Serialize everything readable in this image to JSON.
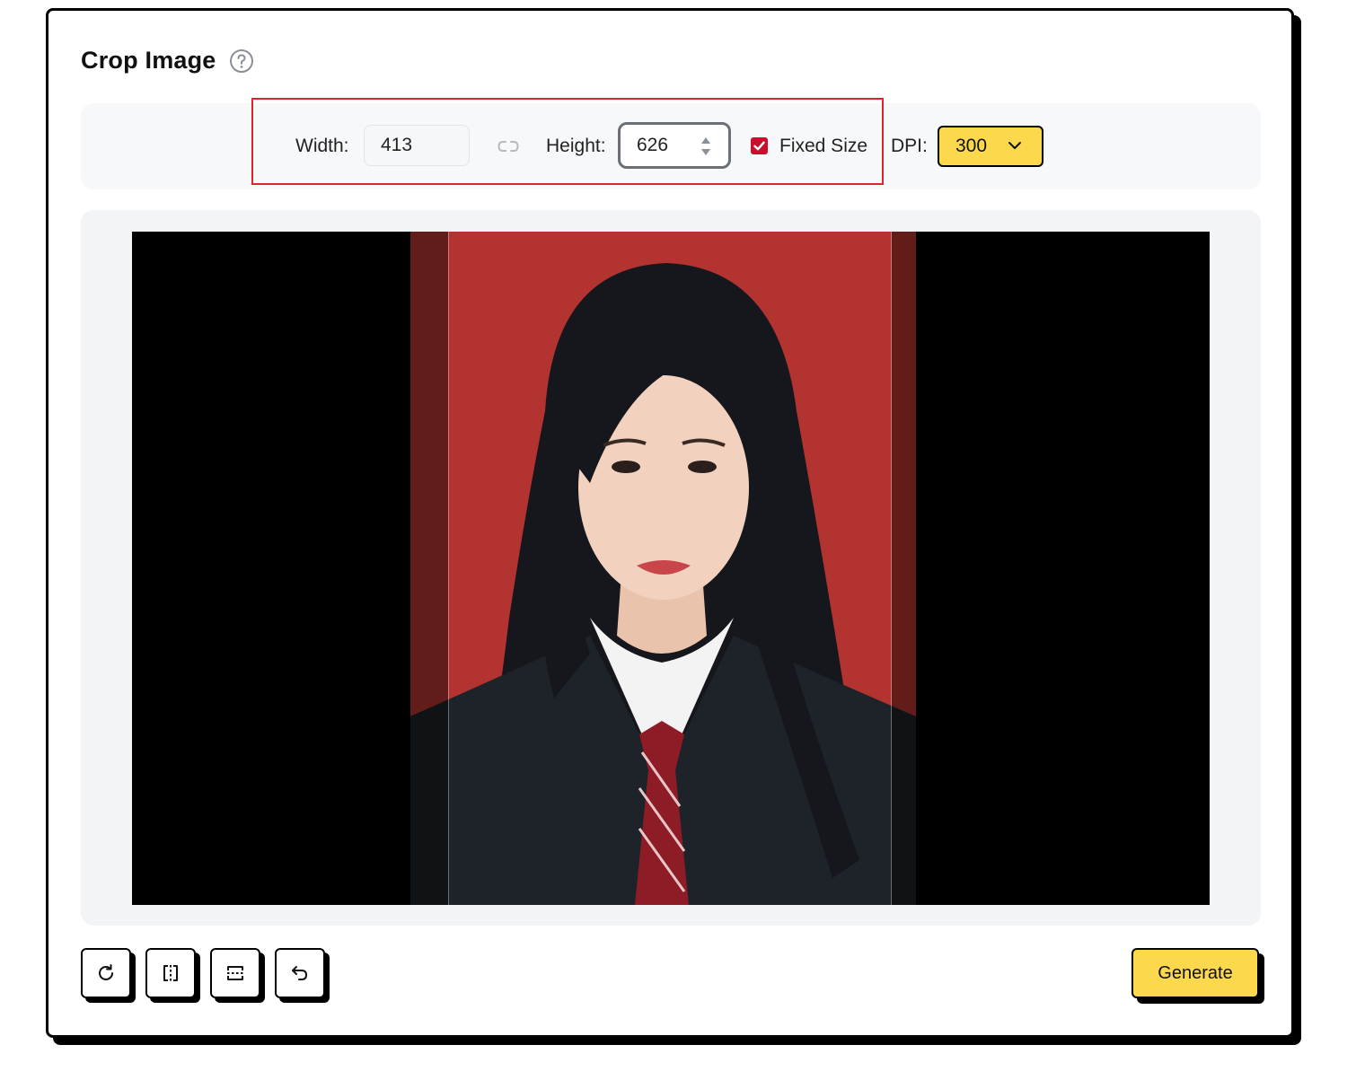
{
  "panel": {
    "title": "Crop Image",
    "help_icon": "question-circle-icon"
  },
  "toolbar": {
    "width_label": "Width:",
    "width_value": "413",
    "link_icon": "link-icon",
    "height_label": "Height:",
    "height_value": "626",
    "fixed_size_label": "Fixed Size",
    "fixed_size_checked": true,
    "dpi_label": "DPI:",
    "dpi_value": "300"
  },
  "actions": {
    "rotate_icon": "rotate-icon",
    "flip_horizontal_icon": "flip-horizontal-icon",
    "flip_vertical_icon": "flip-vertical-icon",
    "undo_icon": "undo-icon",
    "generate_label": "Generate"
  },
  "colors": {
    "accent_yellow": "#fcd94c",
    "checkbox_red": "#c8102e",
    "highlight_red": "#e0242f",
    "photo_background_red": "#b23330"
  }
}
